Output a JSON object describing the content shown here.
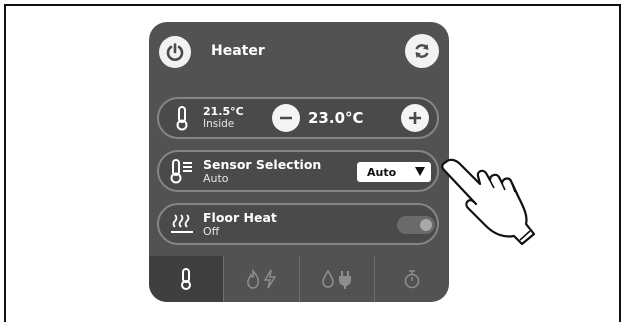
{
  "header": {
    "title": "Heater",
    "power_icon": "power-icon",
    "refresh_icon": "refresh-icon"
  },
  "temperature_row": {
    "icon": "thermometer-icon",
    "inside_value": "21.5°C",
    "inside_label": "Inside",
    "setpoint": "23.0°C"
  },
  "sensor_row": {
    "icon": "thermometer-list-icon",
    "label": "Sensor Selection",
    "sub": "Auto",
    "select_value": "Auto"
  },
  "floor_row": {
    "icon": "floor-heat-icon",
    "label": "Floor Heat",
    "sub": "Off",
    "toggle_on": false
  },
  "bottom_tabs": [
    {
      "icon": "thermometer-icon",
      "active": true
    },
    {
      "icon": "flame-bolt-icon",
      "active": false
    },
    {
      "icon": "drop-plug-icon",
      "active": false
    },
    {
      "icon": "timer-icon",
      "active": false
    }
  ],
  "colors": {
    "panel": "#525252",
    "row_border": "#858585",
    "text": "#ffffff",
    "dim_icon": "#8e8e8e"
  }
}
